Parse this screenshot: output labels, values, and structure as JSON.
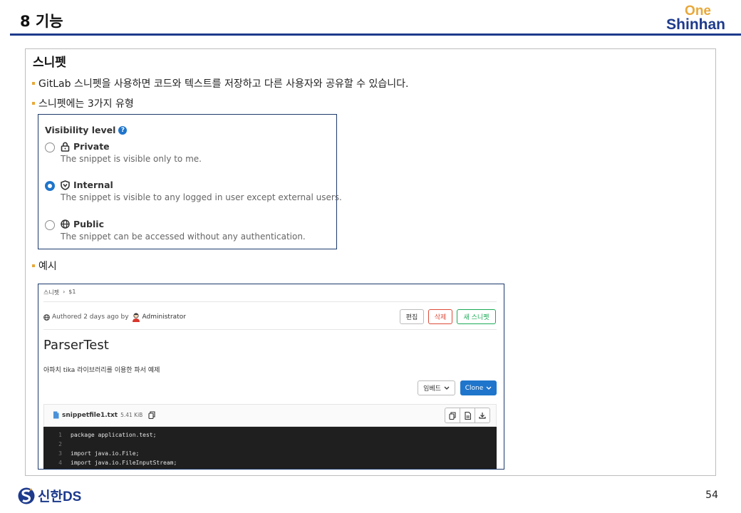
{
  "slide": {
    "title": "8 기능",
    "logo_one": "One",
    "logo_shinhan": "Shinhan",
    "page_number": "54",
    "footer_brand": "신한DS"
  },
  "section": {
    "heading": "스니펫",
    "bullets": [
      "GitLab 스니펫을 사용하면 코드와 텍스트를 저장하고 다른 사용자와 공유할 수 있습니다.",
      "스니펫에는 3가지 유형",
      "예시"
    ]
  },
  "visibility": {
    "title": "Visibility level",
    "help_glyph": "?",
    "options": [
      {
        "label": "Private",
        "description": "The snippet is visible only to me.",
        "checked": false,
        "icon": "lock-icon"
      },
      {
        "label": "Internal",
        "description": "The snippet is visible to any logged in user except external users.",
        "checked": true,
        "icon": "shield-icon"
      },
      {
        "label": "Public",
        "description": "The snippet can be accessed without any authentication.",
        "checked": false,
        "icon": "globe-icon"
      }
    ]
  },
  "example": {
    "breadcrumb": [
      "스니펫",
      "›",
      "$1"
    ],
    "authored": "Authored 2 days ago by",
    "author": "Administrator",
    "buttons": {
      "edit": "편집",
      "delete": "삭제",
      "new": "새 스니펫",
      "embed": "임베드",
      "clone": "Clone"
    },
    "snippet_title": "ParserTest",
    "snippet_description": "아파치 tika 라이브러리를 이용한 파서 예제",
    "file": {
      "name": "snippetfile1.txt",
      "size": "5.41 KiB"
    },
    "code_lines": [
      {
        "num": "1",
        "text": "package application.test;"
      },
      {
        "num": "2",
        "text": ""
      },
      {
        "num": "3",
        "text": "import java.io.File;"
      },
      {
        "num": "4",
        "text": "import java.io.FileInputStream;"
      }
    ]
  },
  "colors": {
    "brand_blue": "#1d3a8c",
    "brand_orange": "#e8a83a",
    "gitlab_blue": "#1f75cb",
    "danger": "#dd4b39",
    "success": "#1aaa55"
  }
}
